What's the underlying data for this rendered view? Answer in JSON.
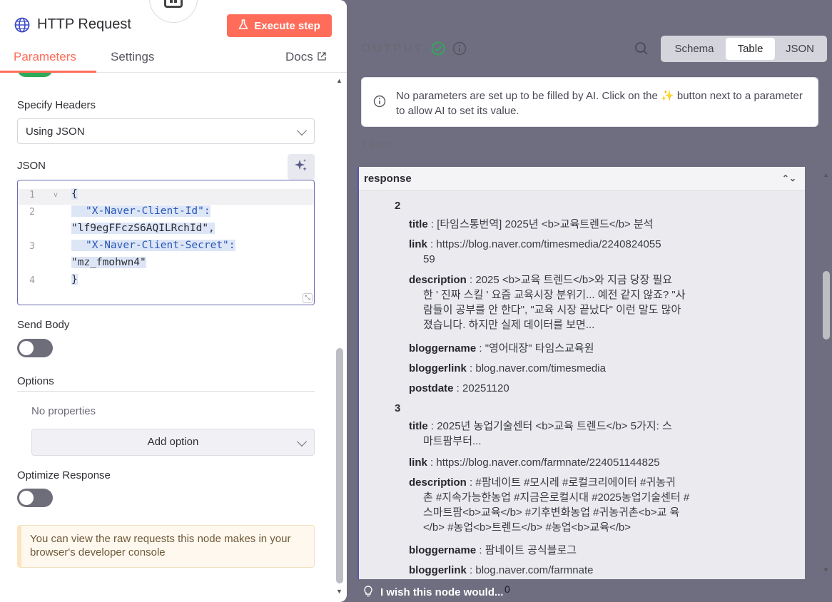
{
  "node": {
    "title": "HTTP Request",
    "execute_label": "Execute step",
    "tabs": [
      "Parameters",
      "Settings"
    ],
    "docs_label": "Docs"
  },
  "params": {
    "specify_headers_label": "Specify Headers",
    "specify_headers_value": "Using JSON",
    "json_label": "JSON",
    "json_lines": [
      {
        "n": "1",
        "text": "{"
      },
      {
        "n": "2",
        "key": "\"X-Naver-Client-Id\":",
        "value": "\"lf9egFFczS6AQILRchId\","
      },
      {
        "n": "3",
        "key": "\"X-Naver-Client-Secret\":",
        "value": "\"mz_fmohwn4\""
      },
      {
        "n": "4",
        "text": "}"
      }
    ],
    "send_body_label": "Send Body",
    "options_label": "Options",
    "no_properties": "No properties",
    "add_option_label": "Add option",
    "optimize_label": "Optimize Response",
    "notice": "You can view the raw requests this node makes in your browser's developer console"
  },
  "output": {
    "label": "OUTPUT",
    "view_tabs": [
      "Schema",
      "Table",
      "JSON"
    ],
    "active_view": "Table",
    "ai_note": "No parameters are set up to be filled by AI. Click on the ✨ button next to a parameter to allow AI to set its value.",
    "items_count": "1 item",
    "column": "response",
    "records": [
      {
        "index": "2",
        "fields": [
          {
            "key": "title",
            "value": "[타임스통번역] 2025년 <b>교육트렌드</b> 분석"
          },
          {
            "key": "link",
            "value": "https://blog.naver.com/timesmedia/2240824055",
            "cont": "59"
          },
          {
            "key": "description",
            "value": "2025 <b>교육 트렌드</b>와 지금 당장 필요",
            "cont": "한 ' 진짜 스킬 ' 요즘 교육시장 분위기... 예전 같지 않죠? \"사 람들이 공부를 안 한다\", \"교육 시장 끝났다\" 이런 말도 많아 졌습니다. 하지만 실제 데이터를 보면..."
          },
          {
            "key": "bloggername",
            "value": "\"영어대장\" 타임스교육원"
          },
          {
            "key": "bloggerlink",
            "value": "blog.naver.com/timesmedia"
          },
          {
            "key": "postdate",
            "value": "20251120"
          }
        ]
      },
      {
        "index": "3",
        "fields": [
          {
            "key": "title",
            "value": "2025년 농업기술센터 <b>교육 트렌드</b> 5가지: 스",
            "cont": "마트팜부터..."
          },
          {
            "key": "link",
            "value": "https://blog.naver.com/farmnate/224051144825"
          },
          {
            "key": "description",
            "value": "#팜네이트 #모시레 #로컬크리에이터 #귀농귀",
            "cont": "촌 #지속가능한농업 #지금은로컬시대 #2025농업기술센터 #스마트팜<b>교육</b> #기후변화농업 #귀농귀촌<b>교 육</b> #농업<b>트렌드</b> #농업<b>교육</b>"
          },
          {
            "key": "bloggername",
            "value": "팜네이트 공식블로그"
          },
          {
            "key": "bloggerlink",
            "value": "blog.naver.com/farmnate"
          }
        ]
      }
    ]
  },
  "footer": {
    "wish_text": "I wish this node would...",
    "wish_count": "0"
  },
  "colors": {
    "accent": "#ff6d5a",
    "success": "#2eaa58",
    "selection": "#5a55a8"
  }
}
